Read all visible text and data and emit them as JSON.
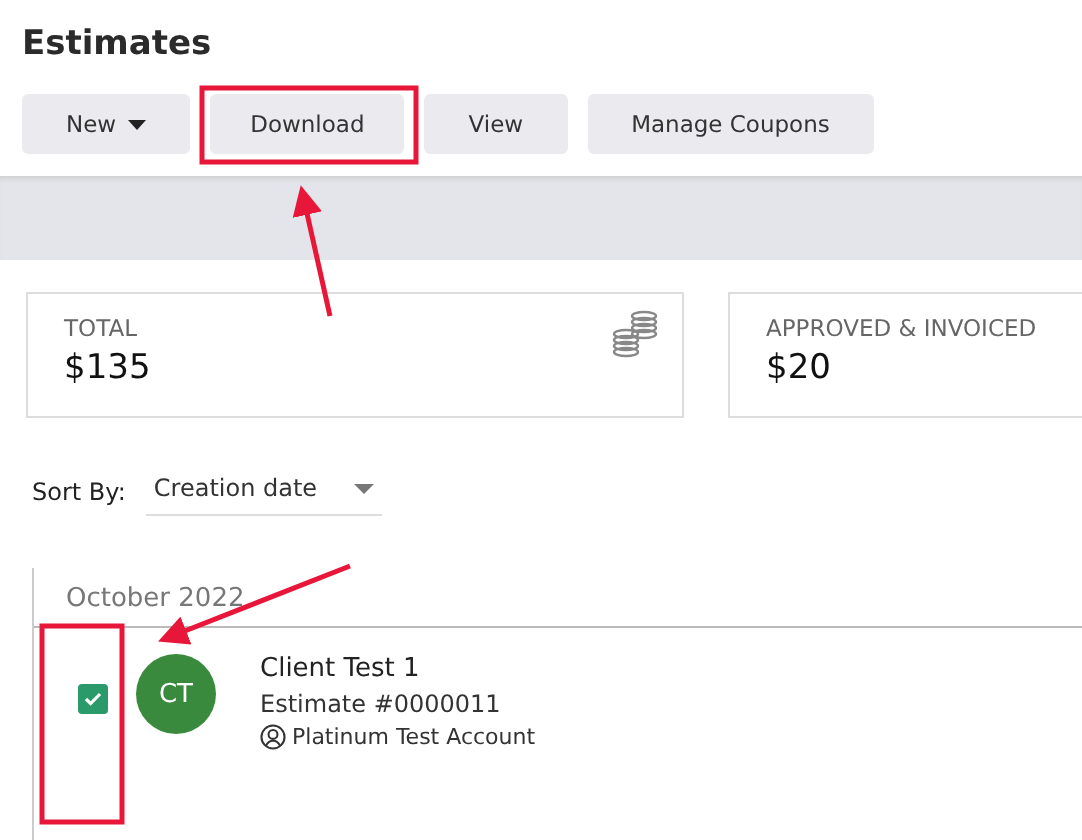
{
  "page_title": "Estimates",
  "toolbar": [
    {
      "label": "New",
      "kind": "dropdown"
    },
    {
      "label": "Download",
      "kind": "plain"
    },
    {
      "label": "View",
      "kind": "plain"
    },
    {
      "label": "Manage Coupons",
      "kind": "plain"
    }
  ],
  "summary_cards": [
    {
      "label": "TOTAL",
      "value": "$135",
      "kind": "coins"
    },
    {
      "label": "APPROVED & INVOICED",
      "value": "$20",
      "kind": "plain"
    }
  ],
  "sort": {
    "label": "Sort By:",
    "value": "Creation date"
  },
  "groups": [
    {
      "heading": "October 2022",
      "items": [
        {
          "checked": true,
          "initials": "CT",
          "color": "#3a8a3e",
          "client": "Client Test 1",
          "number": "Estimate #0000011",
          "account": "Platinum Test Account"
        }
      ]
    }
  ]
}
